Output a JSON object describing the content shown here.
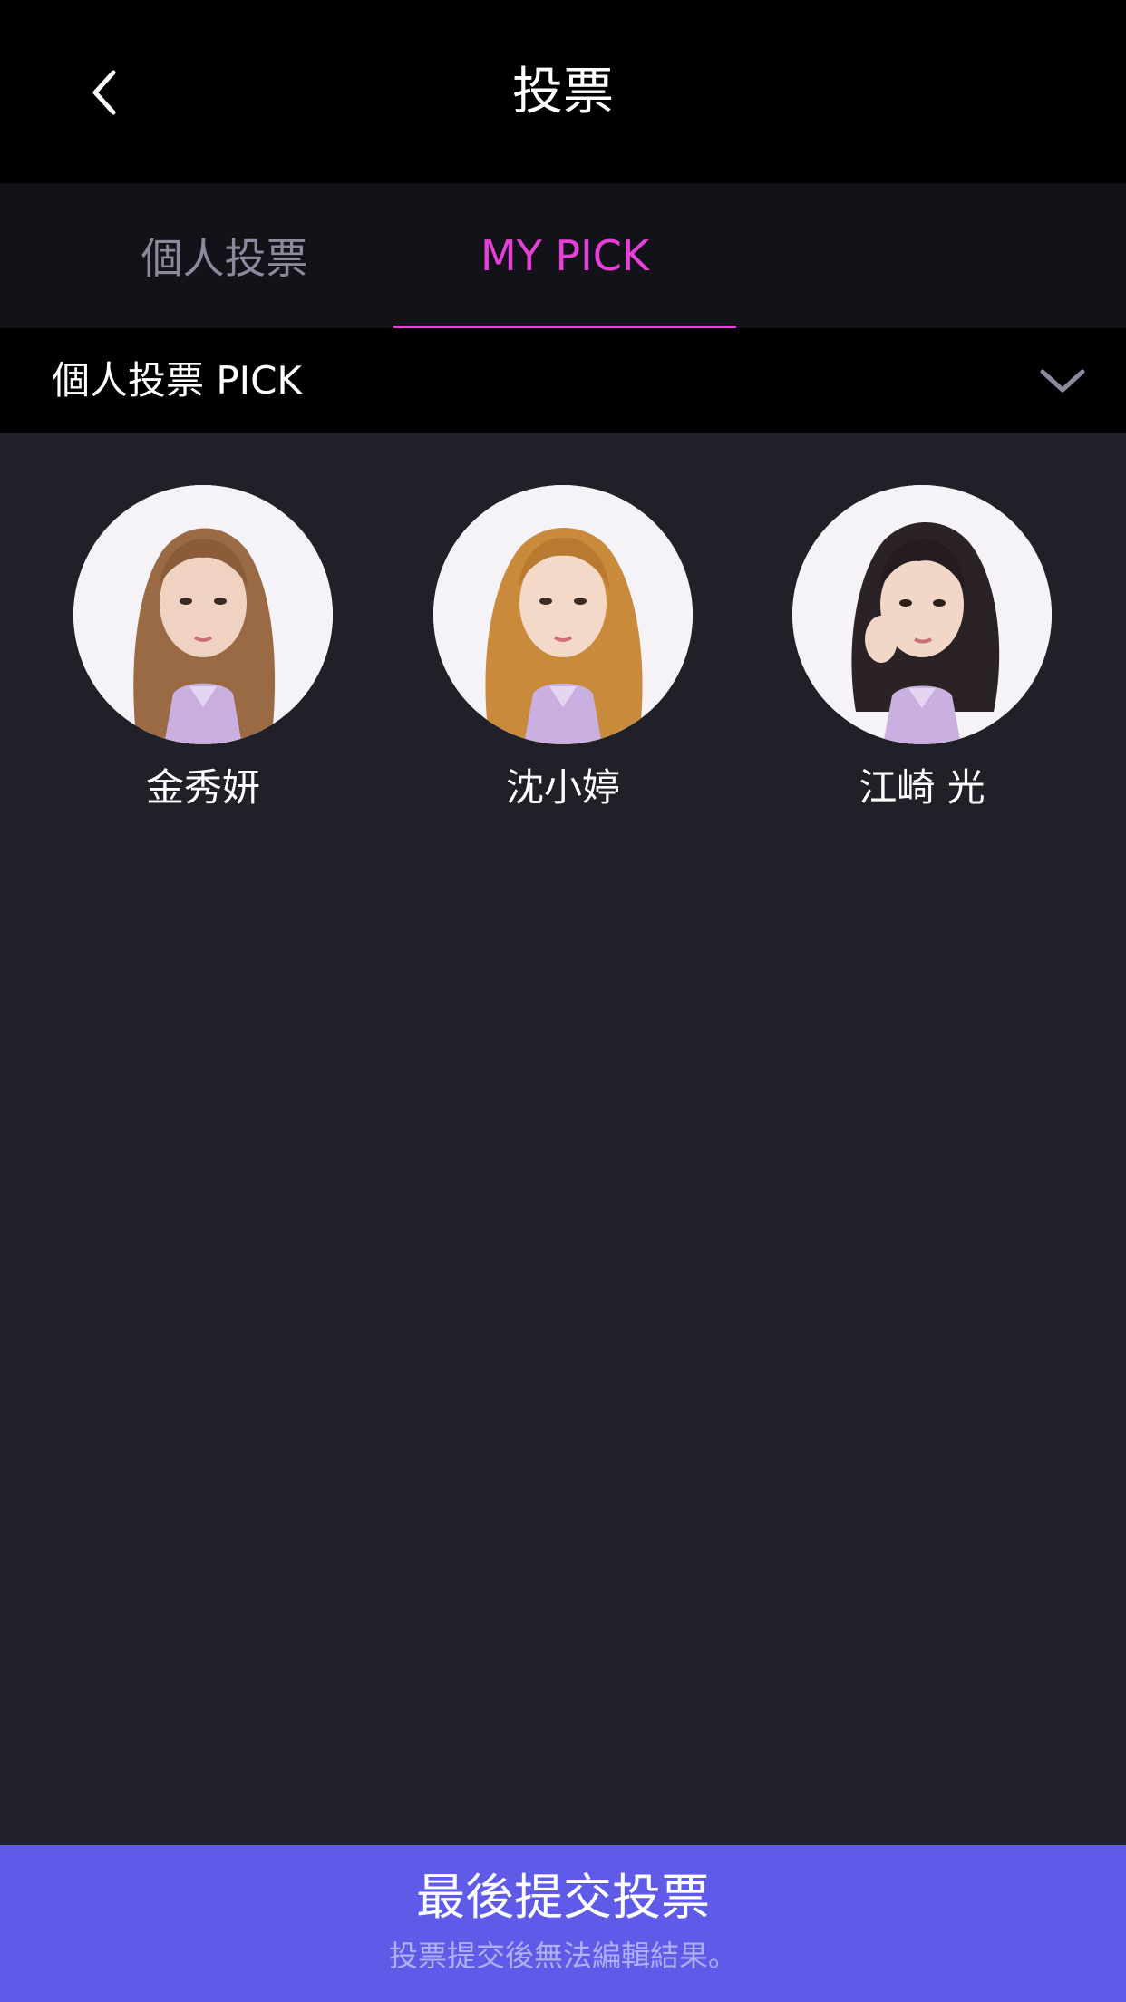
{
  "header": {
    "title": "投票",
    "back_icon": "chevron-left-icon"
  },
  "tabs": [
    {
      "label": "個人投票",
      "active": false
    },
    {
      "label": "MY PICK",
      "active": true
    }
  ],
  "dropdown": {
    "label": "個人投票 PICK",
    "icon": "chevron-down-icon"
  },
  "picks": [
    {
      "name": "金秀妍",
      "hair": "#9a6a44"
    },
    {
      "name": "沈小婷",
      "hair": "#c98a3c"
    },
    {
      "name": "江崎 光",
      "hair": "#2a2224"
    }
  ],
  "submit": {
    "title": "最後提交投票",
    "subtitle": "投票提交後無法編輯結果。"
  },
  "colors": {
    "accent": "#e640d8",
    "submit_bg": "#5f5ae8",
    "background": "#202028"
  }
}
